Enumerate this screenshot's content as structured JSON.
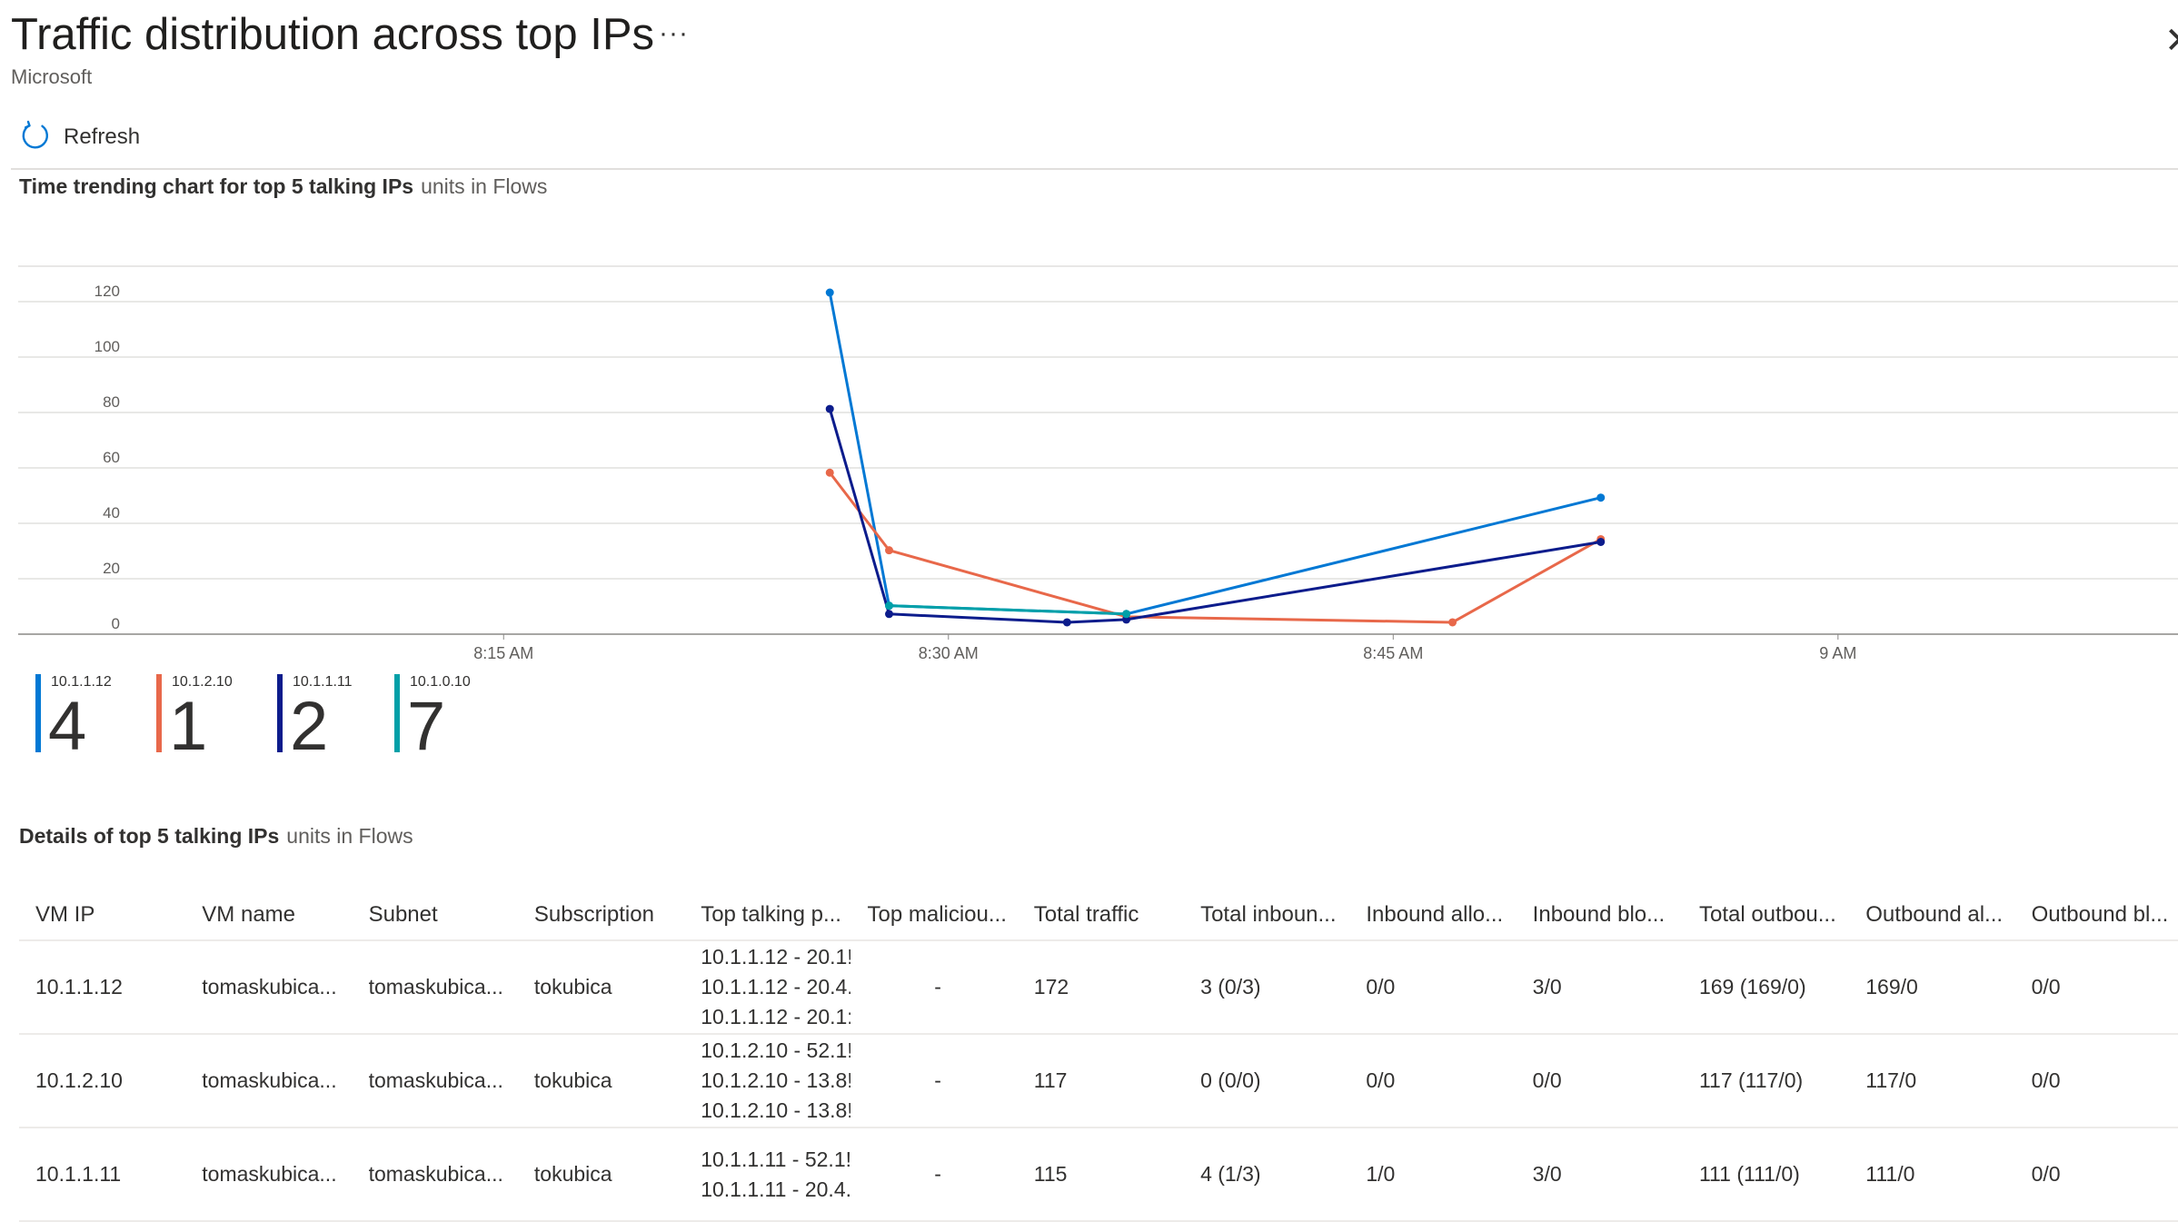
{
  "header": {
    "title": "Traffic distribution across top IPs",
    "more_label": "···",
    "close_label": "✕",
    "subtitle": "Microsoft"
  },
  "toolbar": {
    "refresh_label": "Refresh",
    "refresh_icon": "refresh-icon"
  },
  "chart_section": {
    "title": "Time trending chart for top 5 talking IPs",
    "unit": "units in Flows"
  },
  "chart_data": {
    "type": "line",
    "title": "Time trending chart for top 5 talking IPs",
    "subtitle": "units in Flows",
    "ylim": [
      0,
      120
    ],
    "yticks": [
      0,
      20,
      40,
      60,
      80,
      100,
      120
    ],
    "xticks": [
      "8:15 AM",
      "8:30 AM",
      "8:45 AM",
      "9 AM"
    ],
    "xlim_minutes_after_8am": [
      2,
      65
    ],
    "grid": true,
    "series": [
      {
        "name": "10.1.1.12",
        "color": "#0078d4",
        "x": [
          "8:26 AM",
          "8:28 AM",
          "8:36 AM",
          "8:52 AM"
        ],
        "y": [
          120,
          7,
          4,
          46
        ]
      },
      {
        "name": "10.1.2.10",
        "color": "#e8684a",
        "x": [
          "8:26 AM",
          "8:28 AM",
          "8:36 AM",
          "8:47 AM",
          "8:52 AM"
        ],
        "y": [
          55,
          27,
          3,
          1,
          31
        ]
      },
      {
        "name": "10.1.1.11",
        "color": "#0c1c8c",
        "x": [
          "8:26 AM",
          "8:28 AM",
          "8:34 AM",
          "8:36 AM",
          "8:52 AM"
        ],
        "y": [
          78,
          4,
          1,
          2,
          30
        ]
      },
      {
        "name": "10.1.0.10",
        "color": "#00a0a8",
        "x": [
          "8:28 AM",
          "8:36 AM"
        ],
        "y": [
          7,
          4
        ]
      }
    ]
  },
  "legend": [
    {
      "ip": "10.1.1.12",
      "count": "4",
      "color": "#0078d4"
    },
    {
      "ip": "10.1.2.10",
      "count": "1",
      "color": "#e8684a"
    },
    {
      "ip": "10.1.1.11",
      "count": "2",
      "color": "#0c1c8c"
    },
    {
      "ip": "10.1.0.10",
      "count": "7",
      "color": "#00a0a8"
    }
  ],
  "details_section": {
    "title": "Details of top 5 talking IPs",
    "unit": "units in Flows"
  },
  "table": {
    "columns": [
      "VM IP",
      "VM name",
      "Subnet",
      "Subscription",
      "Top talking p...",
      "Top maliciou...",
      "Total traffic",
      "Total inboun...",
      "Inbound allo...",
      "Inbound blo...",
      "Total outbou...",
      "Outbound al...",
      "Outbound bl..."
    ],
    "rows": [
      {
        "vm_ip": "10.1.1.12",
        "vm_name": "tomaskubica...",
        "subnet": "tomaskubica...",
        "subscription": "tokubica",
        "ports": [
          "10.1.1.12 - 20.1!",
          "10.1.1.12 - 20.4.",
          "10.1.1.12 - 20.1:"
        ],
        "malicious": "-",
        "total": "172",
        "inbound": "3 (0/3)",
        "in_allowed": "0/0",
        "in_blocked": "3/0",
        "outbound": "169 (169/0)",
        "out_allowed": "169/0",
        "out_blocked": "0/0"
      },
      {
        "vm_ip": "10.1.2.10",
        "vm_name": "tomaskubica...",
        "subnet": "tomaskubica...",
        "subscription": "tokubica",
        "ports": [
          "10.1.2.10 - 52.1!",
          "10.1.2.10 - 13.8!",
          "10.1.2.10 - 13.8!"
        ],
        "malicious": "-",
        "total": "117",
        "inbound": "0 (0/0)",
        "in_allowed": "0/0",
        "in_blocked": "0/0",
        "outbound": "117 (117/0)",
        "out_allowed": "117/0",
        "out_blocked": "0/0"
      },
      {
        "vm_ip": "10.1.1.11",
        "vm_name": "tomaskubica...",
        "subnet": "tomaskubica...",
        "subscription": "tokubica",
        "ports": [
          "10.1.1.11 - 52.1!",
          "10.1.1.11 - 20.4."
        ],
        "malicious": "-",
        "total": "115",
        "inbound": "4 (1/3)",
        "in_allowed": "1/0",
        "in_blocked": "3/0",
        "outbound": "111 (111/0)",
        "out_allowed": "111/0",
        "out_blocked": "0/0"
      }
    ]
  }
}
